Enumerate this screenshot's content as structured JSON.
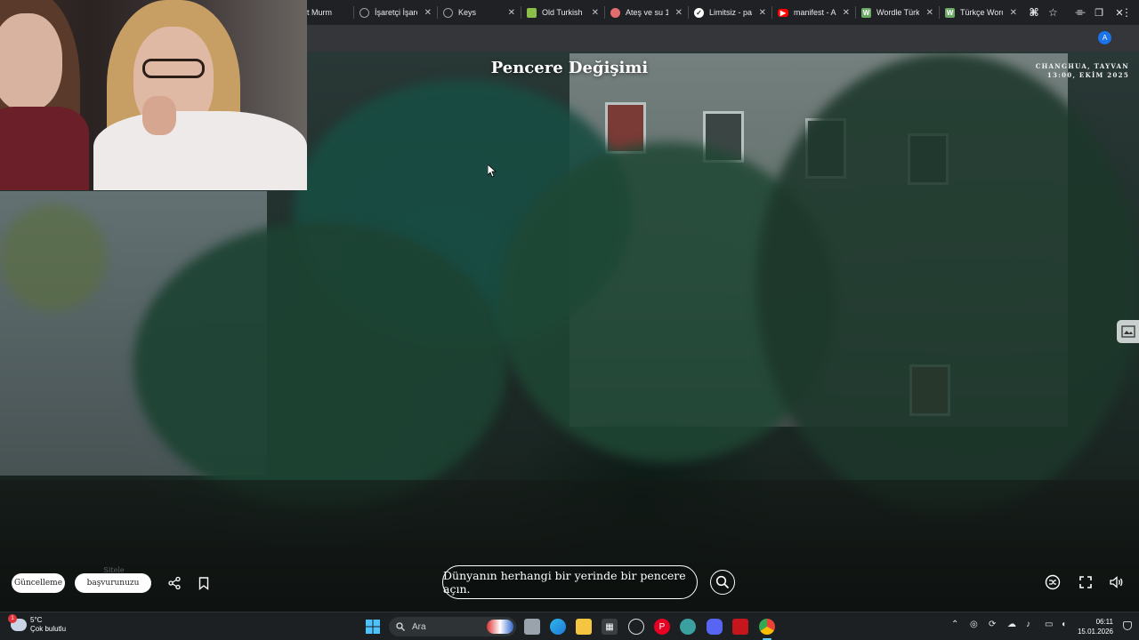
{
  "browser": {
    "tabs": [
      {
        "label": "t Murm",
        "icon": "partial-icon",
        "color": "#202124"
      },
      {
        "label": "İşaretçi İşare",
        "icon": "globe-icon",
        "color": "#9aa0a6"
      },
      {
        "label": "Keys",
        "icon": "globe-icon",
        "color": "#9aa0a6"
      },
      {
        "label": "Old Turkish",
        "icon": "tree-icon",
        "color": "#8bbf4a"
      },
      {
        "label": "Ateş ve su 1",
        "icon": "fire-icon",
        "color": "#e26d6d"
      },
      {
        "label": "Limitsiz - pa",
        "icon": "check-icon",
        "color": "#ffffff"
      },
      {
        "label": "manifest - A",
        "icon": "youtube-icon",
        "color": "#ff0000"
      },
      {
        "label": "Wordle Türk",
        "icon": "wordle-icon",
        "color": "#6aaa64"
      },
      {
        "label": "Türkçe Word",
        "icon": "wordle-icon",
        "color": "#6aaa64"
      }
    ],
    "new_tab": "+",
    "profile_initial": "A"
  },
  "page": {
    "title": "Pencere Değişimi",
    "location_city": "CHANGHUA, TAYVAN",
    "location_time": "13:00, EKİM 2025",
    "update_button": "Güncelleme",
    "apply_button": "başvurunuzu",
    "ghost_text": "Sitele yorumlar",
    "search_prompt": "Dünyanın herhangi bir yerinde bir pencere açın."
  },
  "taskbar": {
    "weather_temp": "5°C",
    "weather_desc": "Çok bulutlu",
    "weather_badge": "1",
    "search_label": "Ara",
    "time": "06:11",
    "date": "15.01.2026"
  },
  "colors": {
    "accent": "#60cdff",
    "tab_bg": "#202124",
    "profile": "#1a73e8"
  }
}
